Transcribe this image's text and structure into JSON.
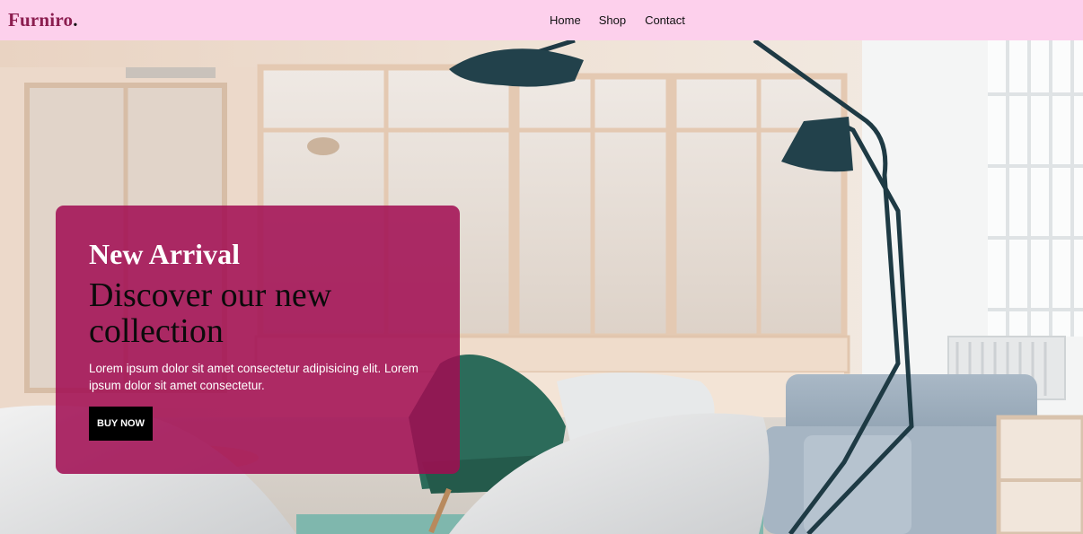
{
  "navbar": {
    "logo_text": "Furniro",
    "logo_dot": ".",
    "links": [
      {
        "label": "Home"
      },
      {
        "label": "Shop"
      },
      {
        "label": "Contact"
      }
    ]
  },
  "hero": {
    "image_description_icon": "living-room-photo",
    "promo": {
      "eyebrow": "New Arrival",
      "title": "Discover our new collection",
      "description": "Lorem ipsum dolor sit amet consectetur adipisicing elit. Lorem ipsum dolor sit amet consectetur.",
      "cta_label": "BUY NOW"
    }
  },
  "colors": {
    "navbar_bg": "#fdd0ec",
    "logo": "#8b1d4f",
    "promo_bg": "#a10c52",
    "button_bg": "#000000"
  }
}
